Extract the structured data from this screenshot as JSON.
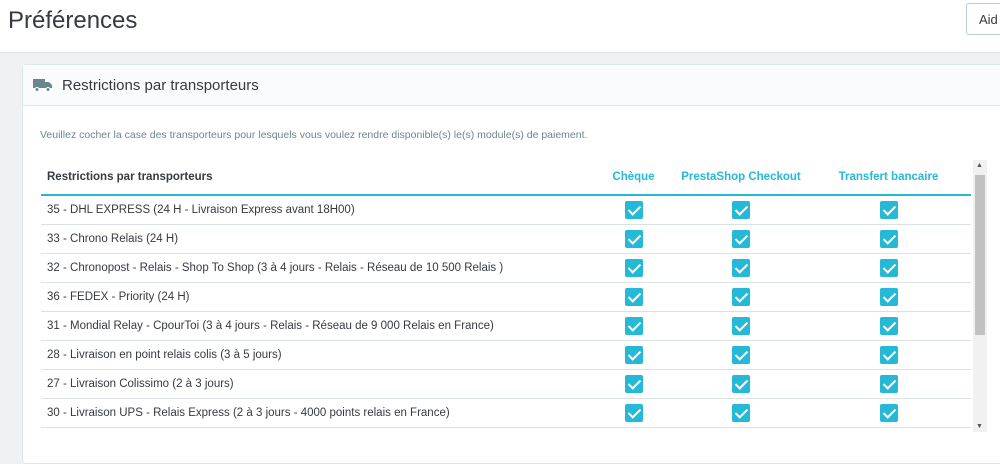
{
  "header": {
    "title": "Préférences",
    "help_label": "Aid"
  },
  "panel": {
    "title": "Restrictions par transporteurs",
    "description": "Veuillez cocher la case des transporteurs pour lesquels vous voulez rendre disponible(s) le(s) module(s) de paiement."
  },
  "table": {
    "columns": [
      "Restrictions par transporteurs",
      "Chèque",
      "PrestaShop Checkout",
      "Transfert bancaire"
    ],
    "rows": [
      {
        "label": "35 - DHL EXPRESS (24 H - Livraison Express avant 18H00)",
        "checked": [
          true,
          true,
          true
        ]
      },
      {
        "label": "33 - Chrono Relais (24 H)",
        "checked": [
          true,
          true,
          true
        ]
      },
      {
        "label": "32 - Chronopost - Relais - Shop To Shop (3 à 4 jours - Relais - Réseau de 10 500 Relais )",
        "checked": [
          true,
          true,
          true
        ]
      },
      {
        "label": "36 - FEDEX - Priority (24 H)",
        "checked": [
          true,
          true,
          true
        ]
      },
      {
        "label": "31 - Mondial Relay - CpourToi (3 à 4 jours - Relais - Réseau de 9 000 Relais en France)",
        "checked": [
          true,
          true,
          true
        ]
      },
      {
        "label": "28 - Livraison en point relais colis (3 à 5 jours)",
        "checked": [
          true,
          true,
          true
        ]
      },
      {
        "label": "27 - Livraison Colissimo (2 à 3 jours)",
        "checked": [
          true,
          true,
          true
        ]
      },
      {
        "label": "30 - Livraison UPS - Relais Express (2 à 3 jours - 4000 points relais en France)",
        "checked": [
          true,
          true,
          true
        ]
      }
    ]
  },
  "colors": {
    "accent": "#25b9d7"
  }
}
